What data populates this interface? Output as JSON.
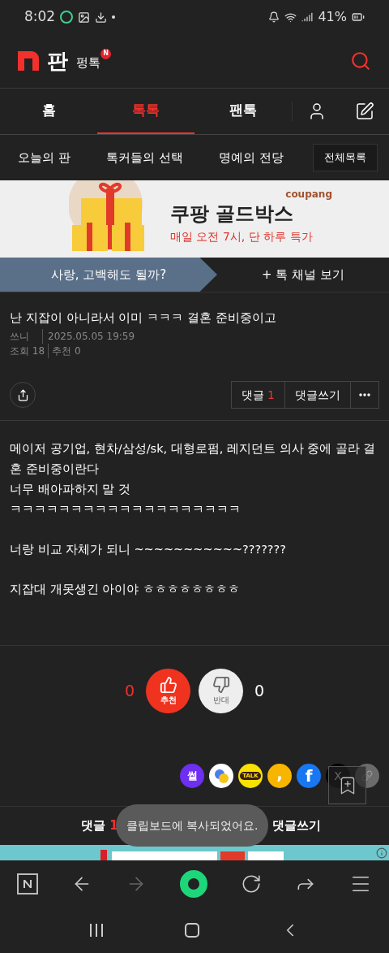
{
  "status_bar": {
    "time": "8:02",
    "battery": "41%"
  },
  "header": {
    "logo_letter": "판",
    "section": "펑톡",
    "new_badge": "N"
  },
  "tabs": [
    {
      "label": "홈",
      "selected": false
    },
    {
      "label": "톡톡",
      "selected": true
    },
    {
      "label": "팬톡",
      "selected": false
    }
  ],
  "subnav": {
    "items": [
      "오늘의 판",
      "톡커들의 선택",
      "명예의 전당"
    ],
    "all_button": "전체목록"
  },
  "ad": {
    "title": "쿠팡 골드박스",
    "subtitle": "매일 오전 7시, 단 하루 특가",
    "brand": "coupang"
  },
  "channel": {
    "name": "사랑, 고백해도 될까?",
    "more": "+ 톡 채널 보기"
  },
  "post": {
    "title": "난 지잡이 아니라서 이미 ㅋㅋㅋ 결혼 준비중이고",
    "author": "쓰니",
    "date": "2025.05.05 19:59",
    "views_label": "조회",
    "views": "18",
    "likes_label": "추천",
    "likes": "0"
  },
  "actions": {
    "comments_label": "댓글",
    "comments_count": "1",
    "write": "댓글쓰기"
  },
  "body": [
    [
      "메이저 공기업, 현차/삼성/sk, 대형로펌, 레지던트 의사 중에 골라 결혼 준비중이란다",
      "너무 배아파하지 말 것",
      "ㅋㅋㅋㅋㅋㅋㅋㅋㅋㅋㅋㅋㅋㅋㅋㅋㅋㅋㅋ"
    ],
    [
      "너랑 비교 자체가 되니 ~~~~~~~~~~~???????"
    ],
    [
      "지잡대 개못생긴 아이야 ㅎㅎㅎㅎㅎㅎㅎㅎ"
    ]
  ],
  "votes": {
    "up_count": "0",
    "up_label": "추천",
    "down_label": "반대",
    "down_count": "0"
  },
  "share": [
    {
      "kind": "ssul",
      "label": "썰"
    },
    {
      "kind": "dots"
    },
    {
      "kind": "talk",
      "label": "TALK"
    },
    {
      "kind": "comma",
      "label": ","
    },
    {
      "kind": "facebook",
      "label": "f"
    },
    {
      "kind": "x",
      "label": "X"
    },
    {
      "kind": "link"
    }
  ],
  "bottom_bar": {
    "comments_label": "댓글",
    "comments_count": "1",
    "write": "댓글쓰기"
  },
  "toast": "클립보드에 복사되었어요."
}
